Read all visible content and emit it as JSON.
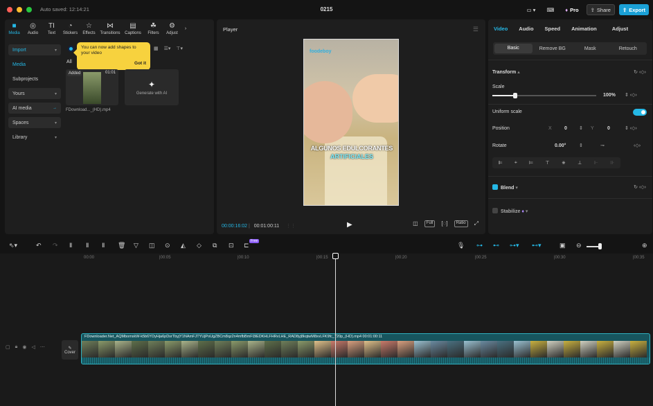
{
  "titlebar": {
    "autosave": "Auto saved: 12:14:21",
    "title": "0215",
    "pro": "Pro",
    "share": "Share",
    "export": "Export"
  },
  "media_toolbar": [
    {
      "label": "Media",
      "icon": "media-icon"
    },
    {
      "label": "Audio",
      "icon": "audio-icon"
    },
    {
      "label": "Text",
      "icon": "text-icon"
    },
    {
      "label": "Stickers",
      "icon": "stickers-icon"
    },
    {
      "label": "Effects",
      "icon": "effects-icon"
    },
    {
      "label": "Transitions",
      "icon": "transitions-icon"
    },
    {
      "label": "Captions",
      "icon": "captions-icon"
    },
    {
      "label": "Filters",
      "icon": "filters-icon"
    },
    {
      "label": "Adjust",
      "icon": "adjust-icon"
    }
  ],
  "sidebar": [
    "Import",
    "Media",
    "Subprojects",
    "Yours",
    "AI media",
    "Spaces",
    "Library"
  ],
  "toast": {
    "text": "You can now add shapes to your video",
    "action": "Got it"
  },
  "media": {
    "filter_all": "All",
    "thumb_added": "Added",
    "thumb_duration": "01:01",
    "thumb_name": "FDownload..._(HD).mp4",
    "generate": "Generate with AI"
  },
  "player": {
    "title": "Player",
    "logo": "foodeboy",
    "caption_line1": "ALGUNOS EDULCORANTES",
    "caption_line2": "ARTIFICIALES",
    "current": "00:00:16:02",
    "total": "00:01:00:11",
    "btn_full": "Full",
    "btn_ratio": "Ratio"
  },
  "props": {
    "tabs": [
      "Video",
      "Audio",
      "Speed",
      "Animation",
      "Adjust"
    ],
    "subtabs": [
      "Basic",
      "Remove BG",
      "Mask",
      "Retouch"
    ],
    "transform": "Transform",
    "scale": "Scale",
    "scale_value": "100%",
    "uniform": "Uniform scale",
    "position": "Position",
    "pos_x_label": "X",
    "pos_x": "0",
    "pos_y_label": "Y",
    "pos_y": "0",
    "rotate": "Rotate",
    "rotate_value": "0.00°",
    "blend": "Blend",
    "stabilize": "Stabilize"
  },
  "timeline": {
    "ruler": [
      "00:00",
      "|00:05",
      "|00:10",
      "|00:15",
      "|00:20",
      "|00:25",
      "|00:30",
      "|00:35"
    ],
    "cover": "Cover",
    "clip_label": "FDownloader.Net_AQMbomxkW-k5b6YOyHja6pDsrTbyjY1NAmFJTYUjPoUgZBCm8qz2n4mfbBmFl3lEDKHLFHRvLHE_RAD8yj8kqtwM8xvLFK9fc_720p_(HD).mp4   00:01:00:11",
    "new_badge": "Free"
  },
  "colors": {
    "accent": "#25b8e6",
    "toast": "#f7d23e",
    "clip": "#17555e"
  }
}
